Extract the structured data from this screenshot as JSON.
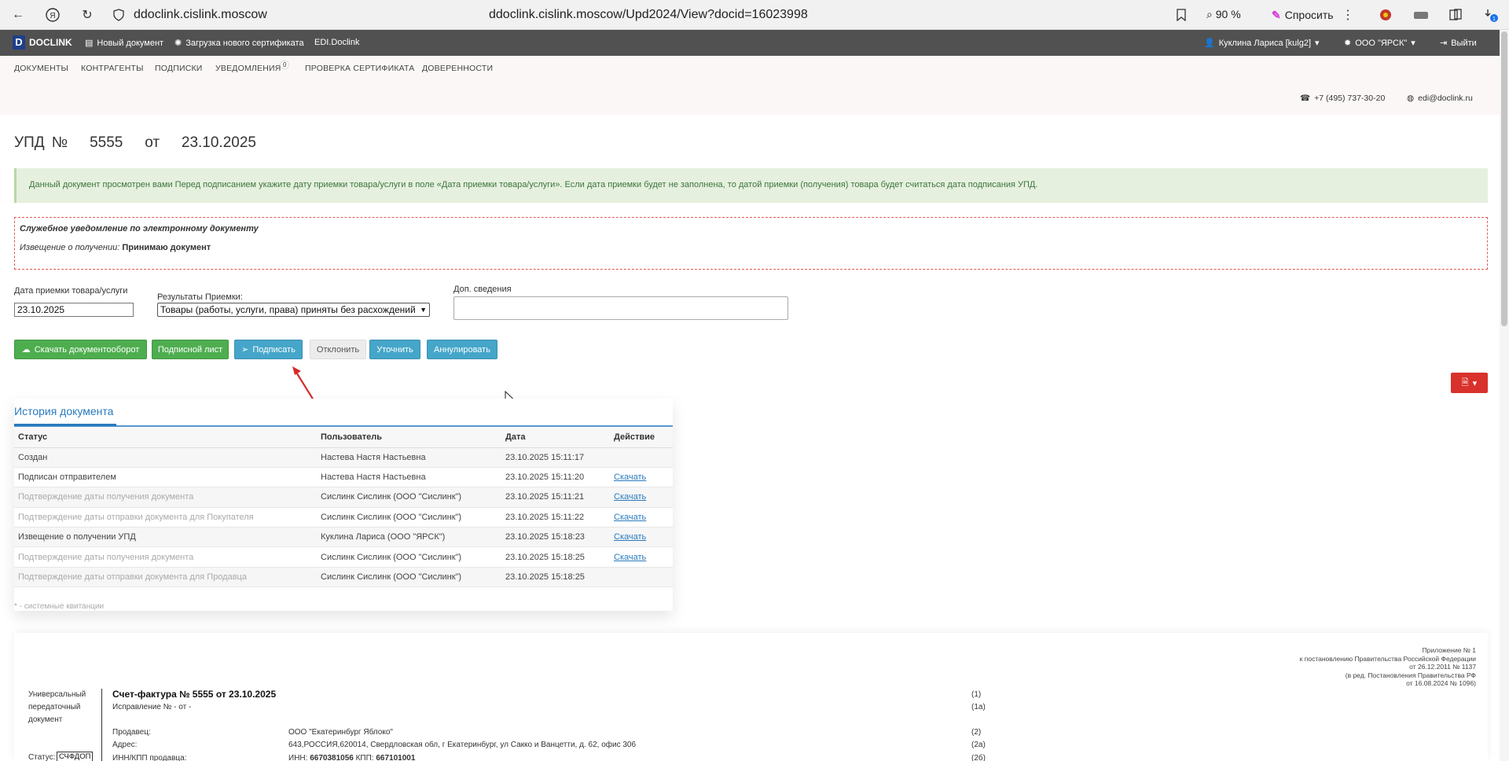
{
  "browser": {
    "domain": "ddoclink.cislink.moscow",
    "url": "ddoclink.cislink.moscow/Upd2024/View?docid=16023998",
    "zoom": "90 %",
    "ask_label": "Спросить",
    "download_badge": "1"
  },
  "app_nav": {
    "logo": "DOCLINK",
    "logo_mark": "D",
    "new_doc": "Новый документ",
    "upload_cert": "Загрузка нового сертификата",
    "edi": "EDI.Doclink",
    "user": "Куклина Лариса [kulg2]",
    "org": "ООО \"ЯРСК\"",
    "logout": "Выйти"
  },
  "sub_nav": {
    "items": [
      "ДОКУМЕНТЫ",
      "КОНТРАГЕНТЫ",
      "ПОДПИСКИ",
      "УВЕДОМЛЕНИЯ",
      "ПРОВЕРКА СЕРТИФИКАТА",
      "ДОВЕРЕННОСТИ"
    ],
    "notifications_count": "0",
    "phone": "+7 (495) 737-30-20",
    "email": "edi@doclink.ru"
  },
  "doc": {
    "title": "УПД №   5555   от   23.10.2025",
    "info": "Данный документ просмотрен вами  Перед подписанием укажите дату приемки товара/услуги в поле «Дата приемки товара/услуги». Если дата приемки будет не заполнена, то датой приемки (получения) товара будет считаться дата подписания УПД.",
    "notice_title": "Служебное уведомление по электронному документу",
    "notice_label": "Извещение о получении:",
    "notice_value": "Принимаю документ"
  },
  "form": {
    "date_label": "Дата приемки товара/услуги",
    "date_value": "23.10.2025",
    "result_label": "Результаты Приемки:",
    "result_value": "Товары (работы, услуги, права) приняты без расхождений",
    "extra_label": "Доп. сведения"
  },
  "buttons": {
    "download_flow": "Скачать документооборот",
    "sign_sheet": "Подписной лист",
    "sign": "Подписать",
    "reject": "Отклонить",
    "clarify": "Уточнить",
    "annul": "Аннулировать"
  },
  "history": {
    "tab": "История документа",
    "columns": [
      "Статус",
      "Пользователь",
      "Дата",
      "Действие"
    ],
    "rows": [
      {
        "status": "Создан",
        "user": "Настева Настя Настьевна",
        "date": "23.10.2025 15:11:17",
        "action": ""
      },
      {
        "status": "Подписан отправителем",
        "user": "Настева Настя Настьевна",
        "date": "23.10.2025 15:11:20",
        "action": "Скачать"
      },
      {
        "status": "Подтверждение даты получения документа",
        "user": "Сислинк Сислинк (ООО \"Сислинк\")",
        "date": "23.10.2025 15:11:21",
        "action": "Скачать"
      },
      {
        "status": "Подтверждение даты отправки документа для Покупателя",
        "user": "Сислинк Сислинк (ООО \"Сислинк\")",
        "date": "23.10.2025 15:11:22",
        "action": "Скачать"
      },
      {
        "status": "Извещение о получении УПД",
        "user": "Куклина Лариса (ООО \"ЯРСК\")",
        "date": "23.10.2025 15:18:23",
        "action": "Скачать"
      },
      {
        "status": "Подтверждение даты получения документа",
        "user": "Сислинк Сислинк (ООО \"Сислинк\")",
        "date": "23.10.2025 15:18:25",
        "action": "Скачать"
      },
      {
        "status": "Подтверждение даты отправки документа для Продавца",
        "user": "Сислинк Сислинк (ООО \"Сислинк\")",
        "date": "23.10.2025 15:18:25",
        "action": ""
      }
    ],
    "footnote": "* - системные квитанции"
  },
  "preview": {
    "appendix": [
      "Приложение № 1",
      "к постановлению Правительства Российской Федерации",
      "от 26.12.2011 № 1137",
      "(в ред. Постановления Правительства РФ",
      "от 16.08.2024 № 1096)"
    ],
    "side": [
      "Универсальный",
      "передаточный",
      "документ"
    ],
    "status_label": "Статус:",
    "status_value": "СЧФДОП",
    "invoice_title": "Счет-фактура № 5555  от 23.10.2025",
    "correction": "Исправление № - от -",
    "seller_label": "Продавец:",
    "seller_value": "ООО \"Екатеринбург Яблоко\"",
    "address_label": "Адрес:",
    "address_value": "643,РОССИЯ,620014, Свердловская обл, г Екатеринбург, ул Сакко и Ванцетти, д. 62, офис 306",
    "inn_label": "ИНН/КПП продавца:",
    "inn_prefix": "ИНН:",
    "inn_value": "6670381056",
    "kpp_prefix": "КПП:",
    "kpp_value": "667101001",
    "refs": [
      "(1)",
      "(1а)",
      "(2)",
      "(2а)",
      "(2б)"
    ]
  },
  "colors": {
    "nav_bg": "#515151",
    "green": "#4eae4f",
    "blue": "#45a6c9",
    "red": "#d9312b",
    "link": "#2a7bbf"
  }
}
